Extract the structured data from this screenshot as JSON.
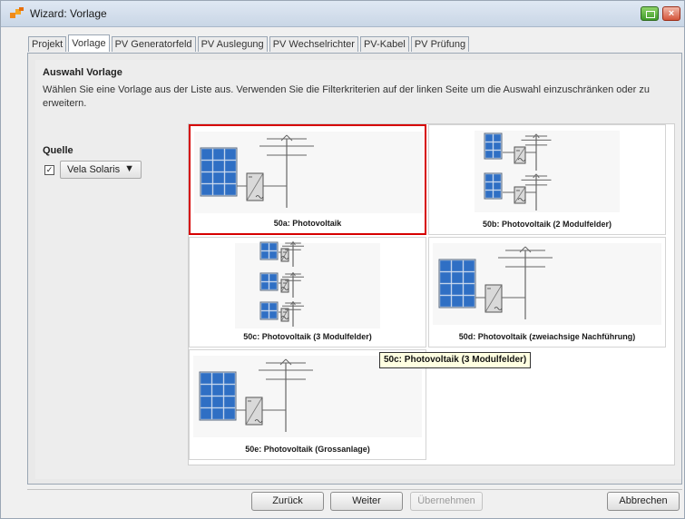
{
  "window": {
    "title": "Wizard: Vorlage"
  },
  "tabs": [
    {
      "label": "Projekt",
      "active": false
    },
    {
      "label": "Vorlage",
      "active": true
    },
    {
      "label": "PV Generatorfeld",
      "active": false
    },
    {
      "label": "PV Auslegung",
      "active": false
    },
    {
      "label": "PV Wechselrichter",
      "active": false
    },
    {
      "label": "PV-Kabel",
      "active": false
    },
    {
      "label": "PV Prüfung",
      "active": false
    }
  ],
  "section": {
    "title": "Auswahl Vorlage",
    "description": "Wählen Sie eine Vorlage aus der Liste aus. Verwenden Sie die Filterkriterien auf der linken Seite um die Auswahl einzuschränken oder zu erweitern."
  },
  "filter": {
    "label": "Quelle",
    "checkbox_checked": true,
    "checkbox_mark": "✓",
    "select_value": "Vela Solaris",
    "select_arrow": "▼"
  },
  "templates": [
    {
      "caption": "50a: Photovoltaik",
      "selected": true,
      "fields": 1
    },
    {
      "caption": "50b: Photovoltaik (2 Modulfelder)",
      "selected": false,
      "fields": 2
    },
    {
      "caption": "50c: Photovoltaik (3 Modulfelder)",
      "selected": false,
      "fields": 3
    },
    {
      "caption": "50d: Photovoltaik (zweiachsige Nachführung)",
      "selected": false,
      "fields": 1
    },
    {
      "caption": "50e: Photovoltaik (Grossanlage)",
      "selected": false,
      "fields": 1
    }
  ],
  "tooltip": "50c: Photovoltaik (3 Modulfelder)",
  "buttons": {
    "back": "Zurück",
    "next": "Weiter",
    "apply": "Übernehmen",
    "cancel": "Abbrechen"
  },
  "colors": {
    "selection_border": "#d60000",
    "panel_blue": "#2f6fc4",
    "tooltip_bg": "#ffffe1"
  },
  "icons": {
    "close": "×"
  }
}
